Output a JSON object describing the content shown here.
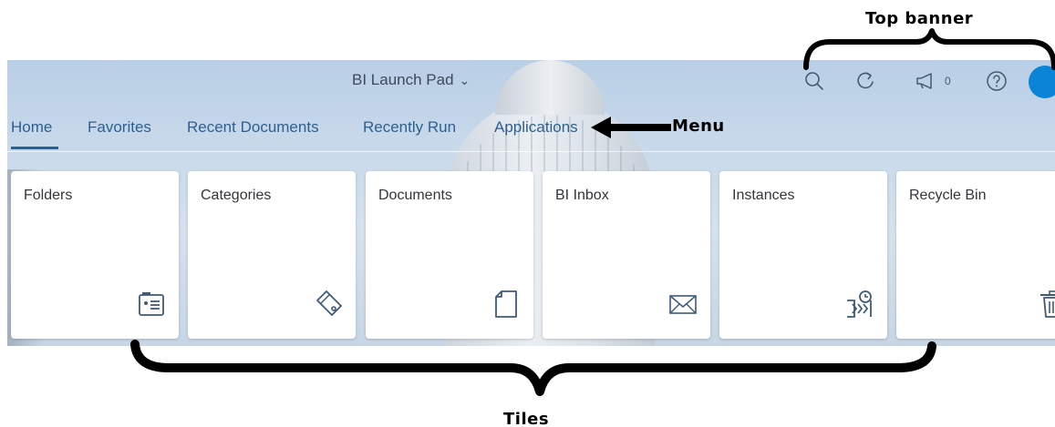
{
  "annotations": {
    "top_banner": "Top banner",
    "menu": "Menu",
    "tiles": "Tiles"
  },
  "header": {
    "app_title": "BI Launch Pad",
    "notification_count": "0",
    "icons": [
      "search-icon",
      "refresh-icon",
      "megaphone-icon",
      "help-icon",
      "avatar"
    ]
  },
  "tabs": [
    {
      "label": "Home",
      "active": true
    },
    {
      "label": "Favorites",
      "active": false
    },
    {
      "label": "Recent Documents",
      "active": false
    },
    {
      "label": "Recently Run",
      "active": false
    },
    {
      "label": "Applications",
      "active": false
    }
  ],
  "tiles": [
    {
      "title": "Folders",
      "icon": "folder-card-icon"
    },
    {
      "title": "Categories",
      "icon": "tag-icon"
    },
    {
      "title": "Documents",
      "icon": "document-icon"
    },
    {
      "title": "BI Inbox",
      "icon": "envelope-icon"
    },
    {
      "title": "Instances",
      "icon": "instances-clock-icon"
    },
    {
      "title": "Recycle Bin",
      "icon": "trash-icon"
    }
  ],
  "colors": {
    "accent": "#2f5f8f",
    "avatar": "#0a84d6",
    "icon": "#3f5a77"
  }
}
